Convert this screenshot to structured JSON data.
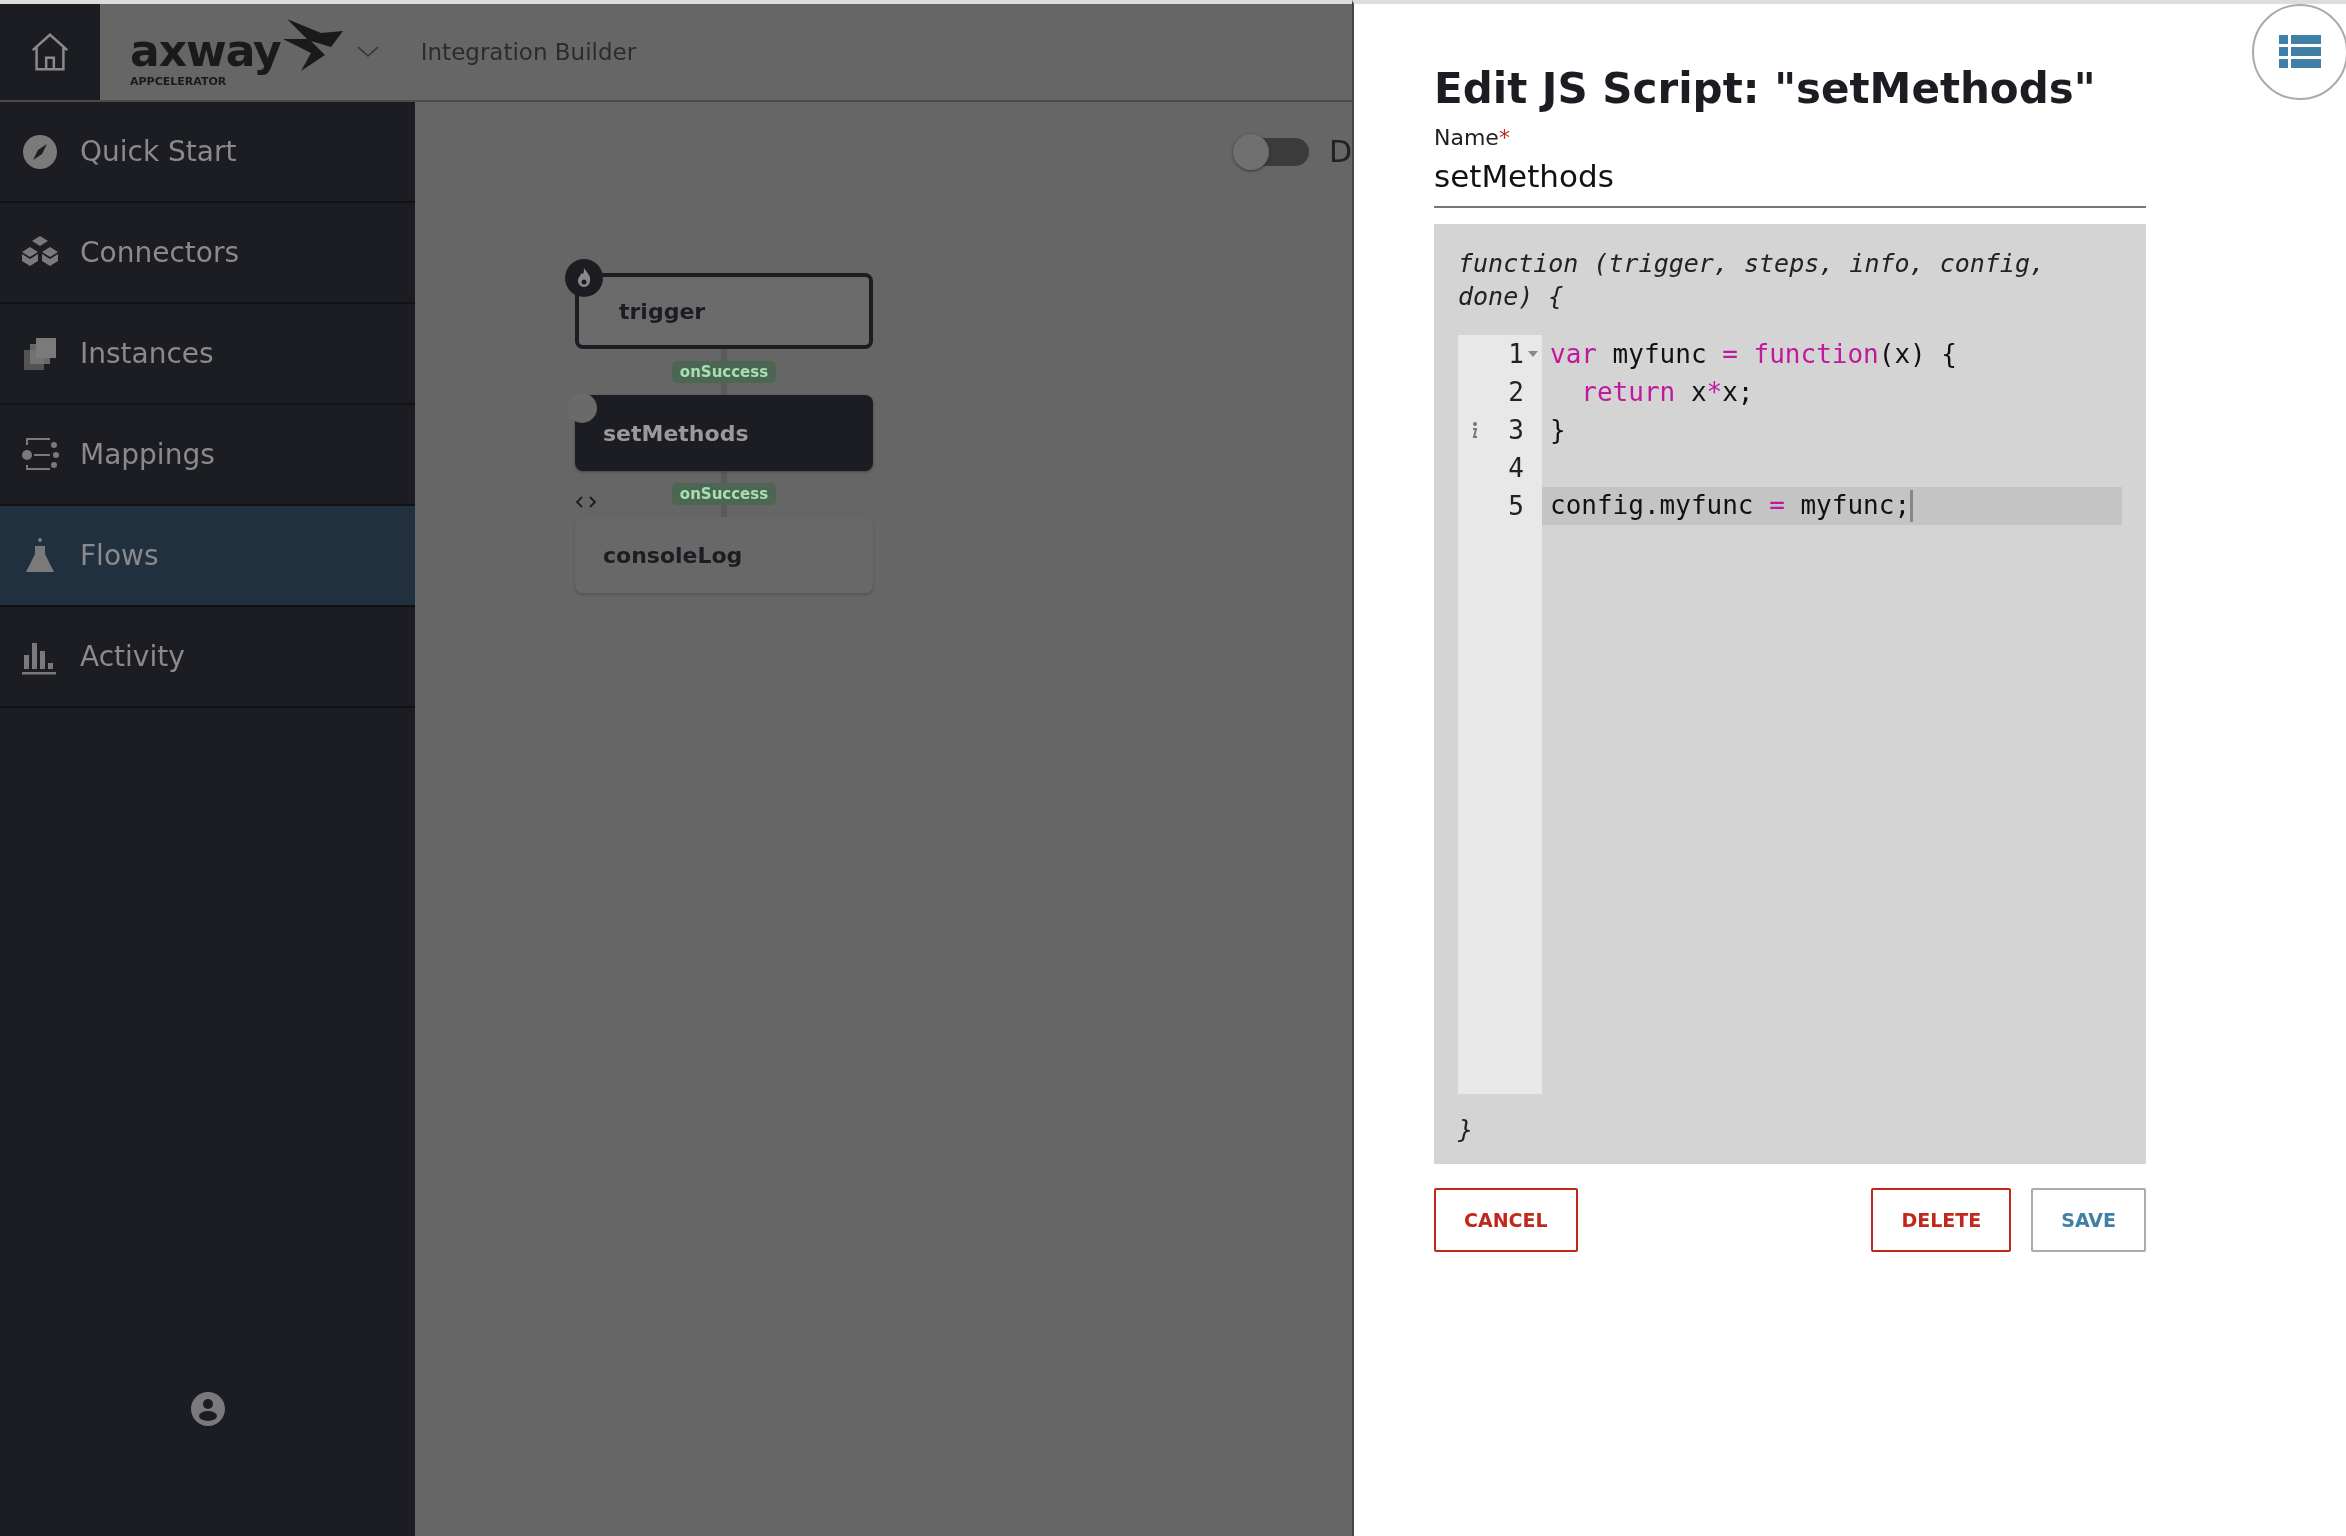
{
  "header": {
    "logo": "axway",
    "logo_sub": "APPCELERATOR",
    "title": "Integration Builder"
  },
  "sidebar": {
    "items": [
      {
        "label": "Quick Start",
        "kind": "compass",
        "selected": false
      },
      {
        "label": "Connectors",
        "kind": "cubes",
        "selected": false
      },
      {
        "label": "Instances",
        "kind": "stack",
        "selected": false
      },
      {
        "label": "Mappings",
        "kind": "mapping",
        "selected": false
      },
      {
        "label": "Flows",
        "kind": "flask",
        "selected": true
      },
      {
        "label": "Activity",
        "kind": "bars",
        "selected": false
      }
    ]
  },
  "canvas": {
    "toggle": {
      "on": false,
      "label": "D"
    },
    "nodes": [
      {
        "kind": "trigger",
        "label": "trigger",
        "selected": false
      },
      {
        "kind": "script",
        "label": "setMethods",
        "selected": true
      },
      {
        "kind": "code",
        "label": "consoleLog",
        "selected": false
      }
    ],
    "edges": [
      {
        "label": "onSuccess"
      },
      {
        "label": "onSuccess"
      }
    ]
  },
  "panel": {
    "title": "Edit JS Script: \"setMethods\"",
    "name_label": "Name",
    "required_mark": "*",
    "name_value": "setMethods",
    "editor": {
      "header": "function (trigger, steps, info, config, done) {",
      "footer": "}",
      "lines": [
        {
          "number": "1",
          "foldable": true,
          "info": false,
          "active": false,
          "tokens": [
            {
              "text": "var",
              "kind": "keyword"
            },
            {
              "text": " myfunc ",
              "kind": "plain"
            },
            {
              "text": "=",
              "kind": "operator"
            },
            {
              "text": " function",
              "kind": "keyword"
            },
            {
              "text": "(x) {",
              "kind": "plain"
            }
          ]
        },
        {
          "number": "2",
          "foldable": false,
          "info": false,
          "active": false,
          "tokens": [
            {
              "text": "  return",
              "kind": "keyword"
            },
            {
              "text": " x",
              "kind": "plain"
            },
            {
              "text": "*",
              "kind": "operator"
            },
            {
              "text": "x;",
              "kind": "plain"
            }
          ]
        },
        {
          "number": "3",
          "foldable": false,
          "info": true,
          "active": false,
          "tokens": [
            {
              "text": "}",
              "kind": "plain"
            }
          ]
        },
        {
          "number": "4",
          "foldable": false,
          "info": false,
          "active": false
        },
        {
          "number": "5",
          "foldable": false,
          "info": false,
          "active": true,
          "tokens": [
            {
              "text": "config.myfunc ",
              "kind": "plain"
            },
            {
              "text": "=",
              "kind": "operator"
            },
            {
              "text": " myfunc;",
              "kind": "plain"
            }
          ]
        }
      ]
    },
    "buttons": [
      {
        "label": "CANCEL",
        "kind": "cancel"
      },
      {
        "label": "DELETE",
        "kind": "danger"
      },
      {
        "label": "SAVE",
        "kind": "primary"
      }
    ]
  }
}
